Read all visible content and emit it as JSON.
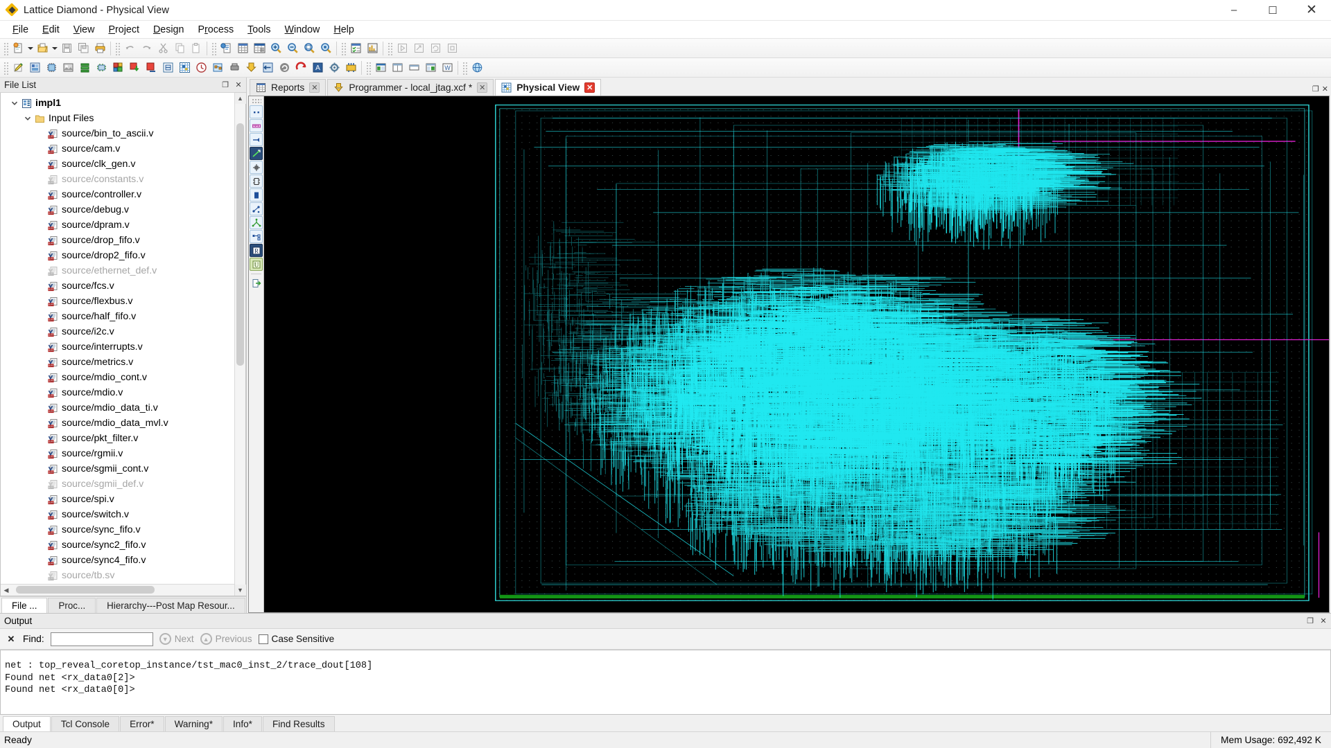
{
  "window": {
    "title": "Lattice Diamond - Physical View",
    "app_icon": "diamond-logo-icon",
    "minimize_glyph": "–",
    "maximize_glyph": "☐",
    "close_glyph": "✕"
  },
  "menu": {
    "items": [
      {
        "label": "File",
        "mnemonic": "F"
      },
      {
        "label": "Edit",
        "mnemonic": "E"
      },
      {
        "label": "View",
        "mnemonic": "V"
      },
      {
        "label": "Project",
        "mnemonic": "P"
      },
      {
        "label": "Design",
        "mnemonic": "D"
      },
      {
        "label": "Process",
        "mnemonic": "r"
      },
      {
        "label": "Tools",
        "mnemonic": "T"
      },
      {
        "label": "Window",
        "mnemonic": "W"
      },
      {
        "label": "Help",
        "mnemonic": "H"
      }
    ]
  },
  "toolbar_row1": {
    "groups": [
      [
        "new-file-icon",
        "new-file-dropdown-icon",
        "open-file-icon",
        "open-file-dropdown-icon",
        "save-icon",
        "save-all-icon",
        "print-icon"
      ],
      [
        "undo-icon",
        "redo-icon",
        "cut-icon",
        "copy-icon",
        "paste-icon"
      ],
      [
        "report-icon",
        "spreadsheet-icon",
        "spreadsheet-view-icon",
        "zoom-in-icon",
        "zoom-out-icon",
        "zoom-fit-icon",
        "zoom-selection-icon"
      ],
      [
        "checklist-icon",
        "chart-icon"
      ],
      [
        "run-icon",
        "run-all-icon",
        "rerun-icon",
        "stop-icon"
      ]
    ]
  },
  "toolbar_row2": {
    "groups": [
      [
        "pencil-edit-icon",
        "device-view-icon",
        "chip-icon",
        "photo-icon",
        "bus-icon",
        "package-icon",
        "floorplan-icon",
        "import-down-icon",
        "export-icon",
        "netlist-icon",
        "physical-view-icon",
        "timing-icon",
        "ngd-view-icon",
        "hardware-icon",
        "programmer-icon",
        "back-annotate-icon",
        "refresh-icon",
        "clear-icon",
        "analysis-icon",
        "settings-gear-icon",
        "power-calc-icon"
      ],
      [
        "tile-horizontal-icon",
        "tile-vertical-icon",
        "single-pane-icon",
        "split-pane-icon",
        "arrange-icon"
      ],
      [
        "web-browser-icon"
      ]
    ]
  },
  "file_list_panel": {
    "title": "File List",
    "float_glyph": "❐",
    "close_glyph": "✕",
    "tree": [
      {
        "label": "impl1",
        "icon": "implementation-icon",
        "depth": 0,
        "expanded": true,
        "bold": true,
        "dim": false
      },
      {
        "label": "Input Files",
        "icon": "folder-icon",
        "depth": 1,
        "expanded": true,
        "bold": false,
        "dim": false
      },
      {
        "label": "source/bin_to_ascii.v",
        "icon": "verilog-file-icon",
        "depth": 2,
        "dim": false
      },
      {
        "label": "source/cam.v",
        "icon": "verilog-file-icon",
        "depth": 2,
        "dim": false
      },
      {
        "label": "source/clk_gen.v",
        "icon": "verilog-file-icon",
        "depth": 2,
        "dim": false
      },
      {
        "label": "source/constants.v",
        "icon": "verilog-file-icon",
        "depth": 2,
        "dim": true
      },
      {
        "label": "source/controller.v",
        "icon": "verilog-file-icon",
        "depth": 2,
        "dim": false
      },
      {
        "label": "source/debug.v",
        "icon": "verilog-file-icon",
        "depth": 2,
        "dim": false
      },
      {
        "label": "source/dpram.v",
        "icon": "verilog-file-icon",
        "depth": 2,
        "dim": false
      },
      {
        "label": "source/drop_fifo.v",
        "icon": "verilog-file-icon",
        "depth": 2,
        "dim": false
      },
      {
        "label": "source/drop2_fifo.v",
        "icon": "verilog-file-icon",
        "depth": 2,
        "dim": false
      },
      {
        "label": "source/ethernet_def.v",
        "icon": "verilog-file-icon",
        "depth": 2,
        "dim": true
      },
      {
        "label": "source/fcs.v",
        "icon": "verilog-file-icon",
        "depth": 2,
        "dim": false
      },
      {
        "label": "source/flexbus.v",
        "icon": "verilog-file-icon",
        "depth": 2,
        "dim": false
      },
      {
        "label": "source/half_fifo.v",
        "icon": "verilog-file-icon",
        "depth": 2,
        "dim": false
      },
      {
        "label": "source/i2c.v",
        "icon": "verilog-file-icon",
        "depth": 2,
        "dim": false
      },
      {
        "label": "source/interrupts.v",
        "icon": "verilog-file-icon",
        "depth": 2,
        "dim": false
      },
      {
        "label": "source/metrics.v",
        "icon": "verilog-file-icon",
        "depth": 2,
        "dim": false
      },
      {
        "label": "source/mdio_cont.v",
        "icon": "verilog-file-icon",
        "depth": 2,
        "dim": false
      },
      {
        "label": "source/mdio.v",
        "icon": "verilog-file-icon",
        "depth": 2,
        "dim": false
      },
      {
        "label": "source/mdio_data_ti.v",
        "icon": "verilog-file-icon",
        "depth": 2,
        "dim": false
      },
      {
        "label": "source/mdio_data_mvl.v",
        "icon": "verilog-file-icon",
        "depth": 2,
        "dim": false
      },
      {
        "label": "source/pkt_filter.v",
        "icon": "verilog-file-icon",
        "depth": 2,
        "dim": false
      },
      {
        "label": "source/rgmii.v",
        "icon": "verilog-file-icon",
        "depth": 2,
        "dim": false
      },
      {
        "label": "source/sgmii_cont.v",
        "icon": "verilog-file-icon",
        "depth": 2,
        "dim": false
      },
      {
        "label": "source/sgmii_def.v",
        "icon": "verilog-file-icon",
        "depth": 2,
        "dim": true
      },
      {
        "label": "source/spi.v",
        "icon": "verilog-file-icon",
        "depth": 2,
        "dim": false
      },
      {
        "label": "source/switch.v",
        "icon": "verilog-file-icon",
        "depth": 2,
        "dim": false
      },
      {
        "label": "source/sync_fifo.v",
        "icon": "verilog-file-icon",
        "depth": 2,
        "dim": false
      },
      {
        "label": "source/sync2_fifo.v",
        "icon": "verilog-file-icon",
        "depth": 2,
        "dim": false
      },
      {
        "label": "source/sync4_fifo.v",
        "icon": "verilog-file-icon",
        "depth": 2,
        "dim": false
      },
      {
        "label": "source/tb.sv",
        "icon": "systemverilog-file-icon",
        "depth": 2,
        "dim": true
      }
    ],
    "dock_tabs": [
      {
        "label": "File ...",
        "active": true
      },
      {
        "label": "Proc...",
        "active": false
      },
      {
        "label": "Hierarchy---Post Map Resour...",
        "active": false
      }
    ]
  },
  "document_tabs": [
    {
      "label": "Reports",
      "icon": "reports-icon",
      "active": false,
      "close_glyph": "✕"
    },
    {
      "label": "Programmer - local_jtag.xcf *",
      "icon": "programmer-icon",
      "active": false,
      "close_glyph": "✕"
    },
    {
      "label": "Physical View",
      "icon": "physical-view-icon",
      "active": true,
      "close_glyph": "✕"
    }
  ],
  "view_toolbar": {
    "buttons": [
      "select-tool-icon",
      "ruler-measure-icon",
      "pan-tool-icon",
      "crosshair-tool-icon",
      "site-tool-icon",
      "component-tool-icon",
      "block-fill-icon",
      "net-connections-icon",
      "route-tool-icon",
      "swap-pins-icon",
      "region-tool-icon",
      "user-constraint-icon",
      "export-view-icon"
    ]
  },
  "canvas": {
    "background_color": "#000000",
    "routing_color": "#20e8f0",
    "magenta_color": "#e020d0",
    "border_color": "#2fd8d8",
    "green_color": "#14a014",
    "grid_dot_color": "#3a4a4a"
  },
  "output_panel": {
    "title": "Output",
    "float_glyph": "❐",
    "close_glyph": "✕",
    "find": {
      "close_glyph": "✕",
      "label": "Find:",
      "value": "",
      "placeholder": "",
      "next_label": "Next",
      "previous_label": "Previous",
      "case_sensitive_label": "Case Sensitive",
      "case_sensitive_checked": false
    },
    "console_lines": [
      "net : top_reveal_coretop_instance/tst_mac0_inst_2/trace_dout[108]",
      "Found net <rx_data0[2]>",
      "Found net <rx_data0[0]>"
    ],
    "tabs": [
      {
        "label": "Output",
        "active": true
      },
      {
        "label": "Tcl Console",
        "active": false
      },
      {
        "label": "Error*",
        "active": false
      },
      {
        "label": "Warning*",
        "active": false
      },
      {
        "label": "Info*",
        "active": false
      },
      {
        "label": "Find Results",
        "active": false
      }
    ]
  },
  "status_bar": {
    "message": "Ready",
    "mem_usage": "Mem Usage:  692,492 K"
  }
}
